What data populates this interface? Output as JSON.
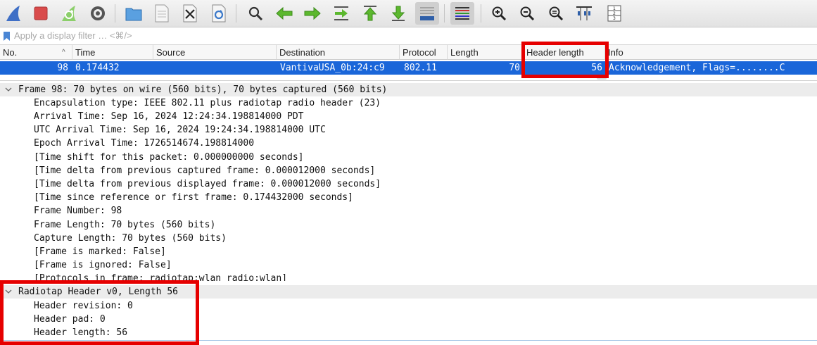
{
  "toolbar": {
    "buttons": [
      {
        "name": "start-capture-icon"
      },
      {
        "name": "stop-capture-icon"
      },
      {
        "name": "restart-capture-icon"
      },
      {
        "name": "capture-options-icon"
      },
      {
        "name": "open-file-icon"
      },
      {
        "name": "save-file-icon"
      },
      {
        "name": "close-file-icon"
      },
      {
        "name": "reload-file-icon"
      },
      {
        "name": "find-packet-icon"
      },
      {
        "name": "go-back-icon"
      },
      {
        "name": "go-forward-icon"
      },
      {
        "name": "go-to-packet-icon"
      },
      {
        "name": "go-to-first-packet-icon"
      },
      {
        "name": "go-to-last-packet-icon"
      },
      {
        "name": "auto-scroll-icon"
      },
      {
        "name": "colorize-icon"
      },
      {
        "name": "zoom-in-icon"
      },
      {
        "name": "zoom-out-icon"
      },
      {
        "name": "normal-size-icon"
      },
      {
        "name": "resize-columns-icon"
      },
      {
        "name": "layout-icon"
      }
    ]
  },
  "filter": {
    "placeholder": "Apply a display filter … <⌘/>"
  },
  "packet_list": {
    "columns": [
      "No.",
      "Time",
      "Source",
      "Destination",
      "Protocol",
      "Length",
      "Header length",
      "Info"
    ],
    "rows": [
      {
        "no": "98",
        "time": "0.174432",
        "source": "",
        "destination": "VantivaUSA_0b:24:c9",
        "protocol": "802.11",
        "length": "70",
        "header_length": "56",
        "info": "Acknowledgement, Flags=........C"
      }
    ]
  },
  "details": {
    "frame": {
      "title": "Frame 98: 70 bytes on wire (560 bits), 70 bytes captured (560 bits)",
      "lines": [
        "Encapsulation type: IEEE 802.11 plus radiotap radio header (23)",
        "Arrival Time: Sep 16, 2024 12:24:34.198814000 PDT",
        "UTC Arrival Time: Sep 16, 2024 19:24:34.198814000 UTC",
        "Epoch Arrival Time: 1726514674.198814000",
        "[Time shift for this packet: 0.000000000 seconds]",
        "[Time delta from previous captured frame: 0.000012000 seconds]",
        "[Time delta from previous displayed frame: 0.000012000 seconds]",
        "[Time since reference or first frame: 0.174432000 seconds]",
        "Frame Number: 98",
        "Frame Length: 70 bytes (560 bits)",
        "Capture Length: 70 bytes (560 bits)",
        "[Frame is marked: False]",
        "[Frame is ignored: False]",
        "[Protocols in frame: radiotap:wlan_radio:wlan]"
      ]
    },
    "radiotap": {
      "title": "Radiotap Header v0, Length 56",
      "lines": [
        "Header revision: 0",
        "Header pad: 0",
        "Header length: 56"
      ]
    }
  },
  "colors": {
    "selection": "#1a66d9",
    "highlight": "#e60000",
    "shark_fin": "#3f6fc6",
    "stop_red": "#d94b4b",
    "arrow_green": "#5cb82e"
  }
}
